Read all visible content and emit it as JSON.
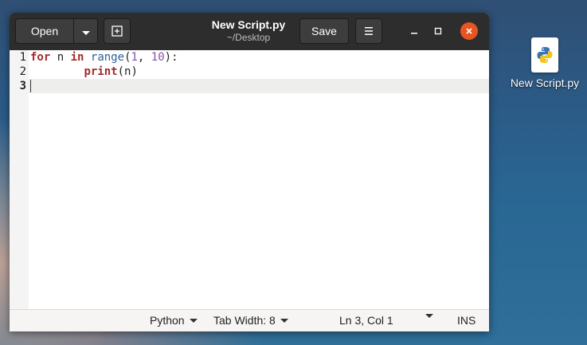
{
  "header": {
    "open_label": "Open",
    "save_label": "Save",
    "title": "New Script.py",
    "subtitle": "~/Desktop"
  },
  "editor": {
    "line_numbers": [
      "1",
      "2",
      "3"
    ],
    "lines": [
      [
        {
          "t": "for",
          "c": "kw"
        },
        {
          "t": " n ",
          "c": ""
        },
        {
          "t": "in",
          "c": "kw"
        },
        {
          "t": " ",
          "c": ""
        },
        {
          "t": "range",
          "c": "bi"
        },
        {
          "t": "(",
          "c": ""
        },
        {
          "t": "1",
          "c": "num"
        },
        {
          "t": ", ",
          "c": ""
        },
        {
          "t": "10",
          "c": "num"
        },
        {
          "t": "):",
          "c": ""
        }
      ],
      [
        {
          "t": "        ",
          "c": ""
        },
        {
          "t": "print",
          "c": "fn"
        },
        {
          "t": "(n)",
          "c": ""
        }
      ],
      []
    ],
    "current_line": 3
  },
  "statusbar": {
    "language": "Python",
    "tab_width": "Tab Width: 8",
    "position": "Ln 3, Col 1",
    "mode": "INS"
  },
  "desktop": {
    "file_label": "New Script.py"
  },
  "colors": {
    "headerbar": "#2d2d2d",
    "close_button": "#e95420",
    "keyword": "#a52a2a",
    "builtin": "#2a6099",
    "number": "#8a4fb0"
  }
}
